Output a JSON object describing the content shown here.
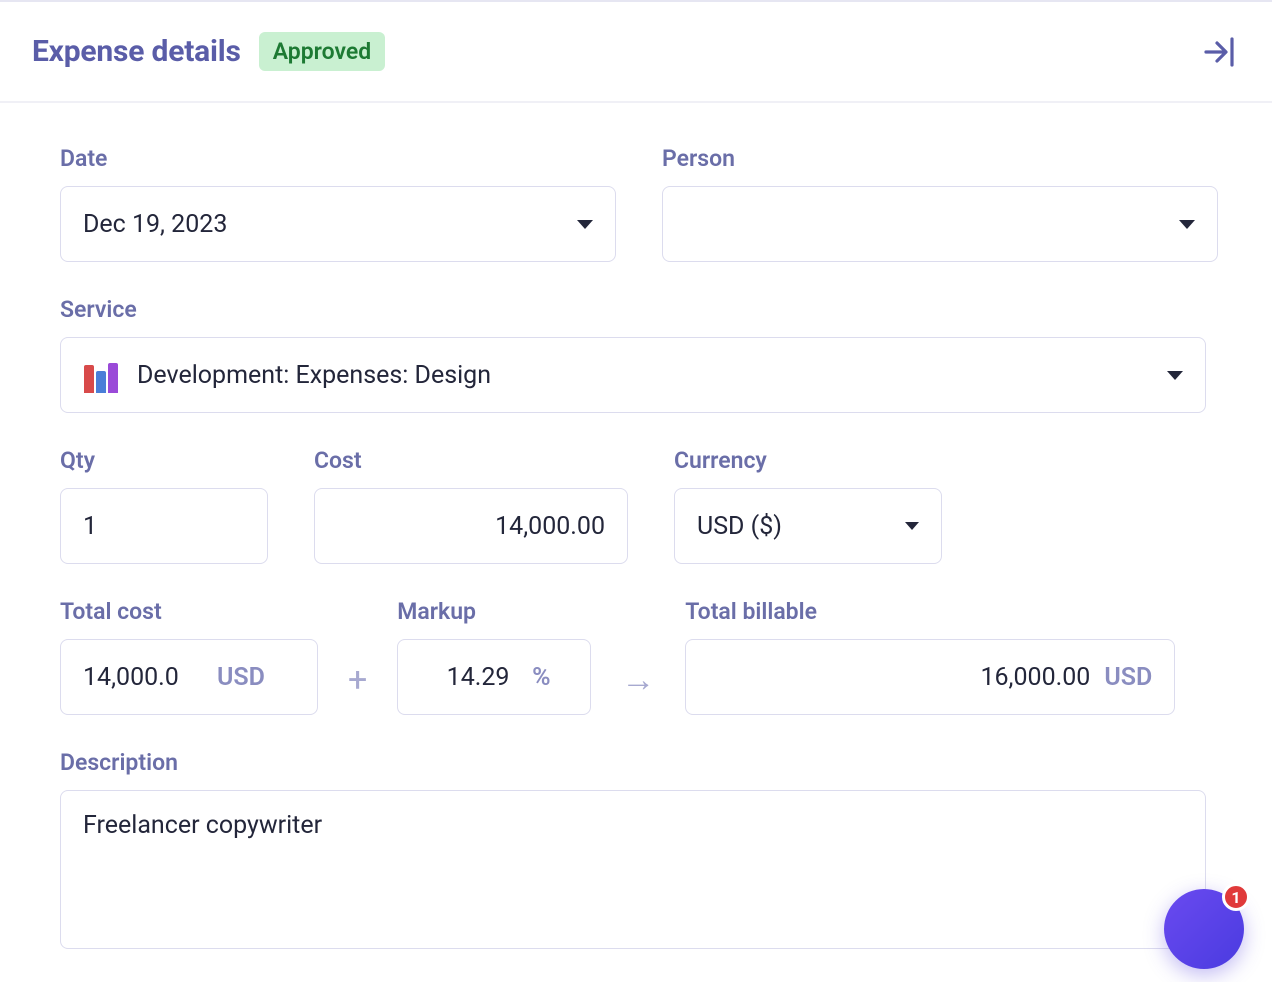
{
  "header": {
    "title": "Expense details",
    "status": "Approved",
    "collapse_icon": "collapse-panel-icon"
  },
  "fields": {
    "date": {
      "label": "Date",
      "value": "Dec 19, 2023"
    },
    "person": {
      "label": "Person",
      "value": ""
    },
    "service": {
      "label": "Service",
      "value": "Development: Expenses: Design"
    },
    "qty": {
      "label": "Qty",
      "value": "1"
    },
    "cost": {
      "label": "Cost",
      "value": "14,000.00"
    },
    "currency": {
      "label": "Currency",
      "value": "USD ($)"
    },
    "total_cost": {
      "label": "Total cost",
      "value": "14,000.0",
      "unit": "USD"
    },
    "markup": {
      "label": "Markup",
      "value": "14.29",
      "unit": "%"
    },
    "total_bill": {
      "label": "Total billable",
      "value": "16,000.00",
      "unit": "USD"
    },
    "description": {
      "label": "Description",
      "value": "Freelancer copywriter"
    }
  },
  "fab": {
    "badge": "1"
  }
}
